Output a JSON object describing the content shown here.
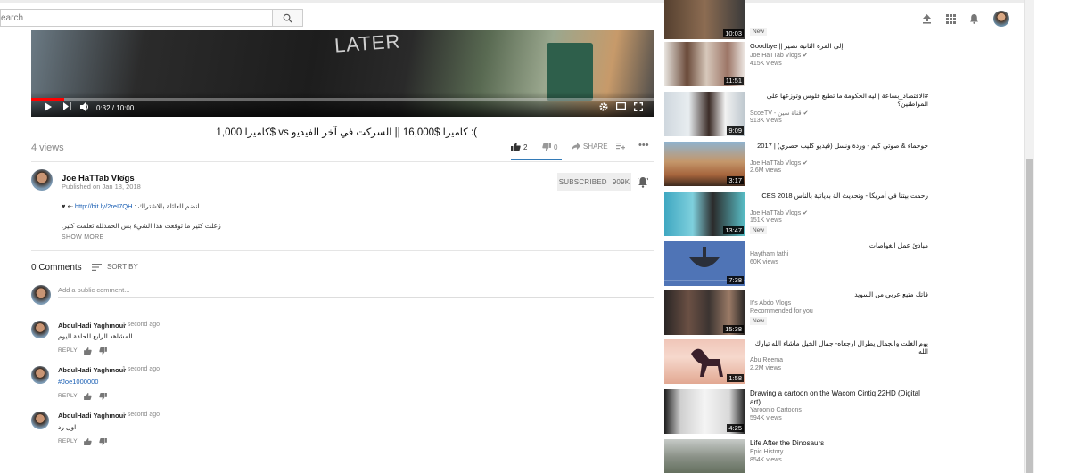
{
  "search": {
    "placeholder": "earch"
  },
  "video": {
    "shirt_text": "LATER",
    "time_display": "0:32 / 10:00",
    "progress": 0.053,
    "title": "): كاميرا $16,000 || السركت في آخر الفيديو vs $كاميرا 1,000",
    "views": "4 views",
    "likes": "2",
    "dislikes": "0",
    "share_label": "SHARE"
  },
  "channel": {
    "name": "Joe HaTTab Vlogs",
    "published": "Published on Jan 18, 2018",
    "subscribe_label": "SUBSCRIBED",
    "subscriber_count": "909K",
    "desc_prefix": "♥ ⇠ ",
    "desc_link": "http://bit.ly/2reI7QH",
    "desc_suffix": " : انضم للعائلة بالاشتراك",
    "desc_line2": "زعلت كثير ما توقعت هذا الشيء بس الحمدلله تعلمت كثير.",
    "show_more": "SHOW MORE"
  },
  "comments": {
    "count_label": "0 Comments",
    "sort_label": "SORT BY",
    "add_placeholder": "Add a public comment...",
    "items": [
      {
        "author": "AbdulHadi Yaghmour",
        "time": "1 second ago",
        "text": "المشاهد الرابع للحلقة اليوم",
        "reply": "REPLY"
      },
      {
        "author": "AbdulHadi Yaghmour",
        "time": "1 second ago",
        "text": "#Joe1000000",
        "reply": "REPLY"
      },
      {
        "author": "AbdulHadi Yaghmour",
        "time": "1 second ago",
        "text": "اول رد",
        "reply": "REPLY"
      }
    ]
  },
  "sidebar": {
    "partial_top": {
      "duration": "10:03",
      "badge": "New"
    },
    "items": [
      {
        "title": "Goodbye || إلى المرة الثانية نصير",
        "channel": "Joe HaTTab Vlogs ✔",
        "views": "415K views",
        "duration": "11:51",
        "badge": ""
      },
      {
        "title": "#الاقتصاد_بساعة | ليه الحكومة ما تطبع فلوس وتوزعها على المواطنين؟",
        "channel": "ScoeTV - قناة سين ✔",
        "views": "913K views",
        "duration": "9:09",
        "badge": ""
      },
      {
        "title": "حوحماء & صوتي كيم - وردة ونسل (فيديو كليب حصري) | 2017",
        "channel": "Joe HaTTab Vlogs ✔",
        "views": "2.6M views",
        "duration": "3:17",
        "badge": ""
      },
      {
        "title": "رحمت بيتنا في أمريكا - وتحديث آلة بدياتية بالناس CES 2018",
        "channel": "Joe HaTTab Vlogs ✔",
        "views": "151K views",
        "duration": "13:47",
        "badge": "New"
      },
      {
        "title": "مبادئ عمل الغواصات",
        "channel": "Haytham fathi",
        "views": "60K views",
        "duration": "7:38",
        "badge": ""
      },
      {
        "title": "فاتك متبع عربي من السويد",
        "channel": "It's Abdo Vlogs",
        "views": "Recommended for you",
        "duration": "15:38",
        "badge": "New"
      },
      {
        "title": "يوم الغلت والجمال يطرال ارجعاه- جمال الخيل ماشاء الله تبارك الله",
        "channel": "Abu Reema",
        "views": "2.2M views",
        "duration": "1:58",
        "badge": ""
      },
      {
        "title": "Drawing a cartoon on the Wacom Cintiq 22HD (Digital art)",
        "channel": "Yaroonio Cartoons",
        "views": "594K views",
        "duration": "4:25",
        "badge": ""
      },
      {
        "title": "Life After the Dinosaurs",
        "channel": "Epic History",
        "views": "854K views",
        "duration": "",
        "badge": ""
      }
    ]
  }
}
